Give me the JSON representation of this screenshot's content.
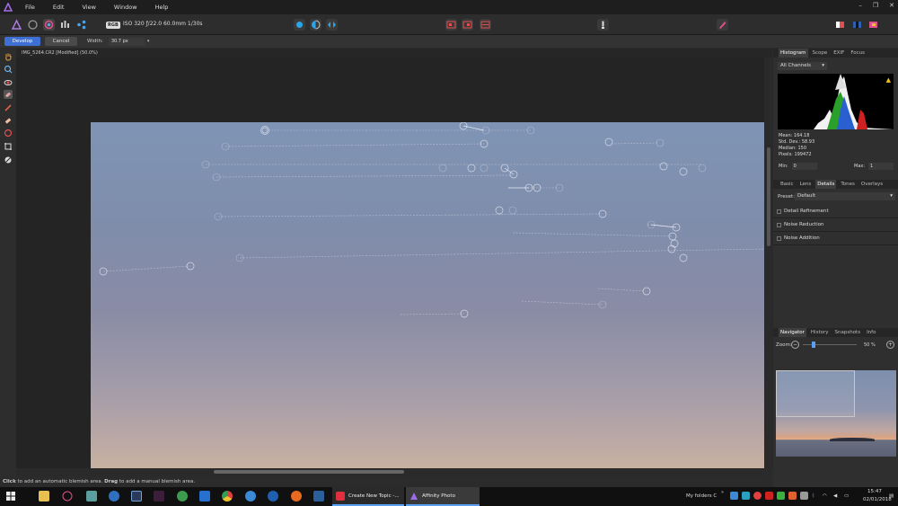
{
  "menu": [
    "File",
    "Edit",
    "View",
    "Window",
    "Help"
  ],
  "window_controls": {
    "minimize": "–",
    "restore": "❐",
    "close": "✕"
  },
  "toolbar": {
    "color_badge": "RGB",
    "exif": "ISO 320 ƒ/22.0 60.0mm 1/30s"
  },
  "context": {
    "develop": "Develop",
    "cancel": "Cancel",
    "width_label": "Width:",
    "width_value": "30.7 px"
  },
  "document_title": "IMG_5264.CR2 [Modified] (50.0%)",
  "status_bar": {
    "bold1": "Click",
    "text1": " to add an automatic blemish area. ",
    "bold2": "Drag",
    "text2": " to add a manual blemish area."
  },
  "histogram_panel": {
    "tabs": [
      "Histogram",
      "Scope",
      "EXIF",
      "Focus"
    ],
    "channel": "All Channels",
    "stats": [
      "Mean: 164.18",
      "Std. Dev.: 58.93",
      "Median: 150",
      "Pixels: 199472"
    ],
    "min_label": "Min:",
    "min_value": "0",
    "max_label": "Max:",
    "max_value": "1"
  },
  "develop_panel": {
    "tabs": [
      "Basic",
      "Lens",
      "Details",
      "Tones",
      "Overlays"
    ],
    "preset_label": "Preset:",
    "preset_value": "Default",
    "rows": [
      "Detail Refinement",
      "Noise Reduction",
      "Noise Addition"
    ]
  },
  "navigator_panel": {
    "tabs": [
      "Navigator",
      "History",
      "Snapshots",
      "Info"
    ],
    "zoom_label": "Zoom:",
    "zoom_value": "50 %"
  },
  "taskbar": {
    "open_windows": [
      "Create New Topic -...",
      "Affinity Photo"
    ],
    "tray_label": "My folders C",
    "time": "15:47",
    "date": "02/01/2018"
  },
  "colors": {
    "accent": "#3d6fd4",
    "app_purple": "#7b4fd6"
  }
}
